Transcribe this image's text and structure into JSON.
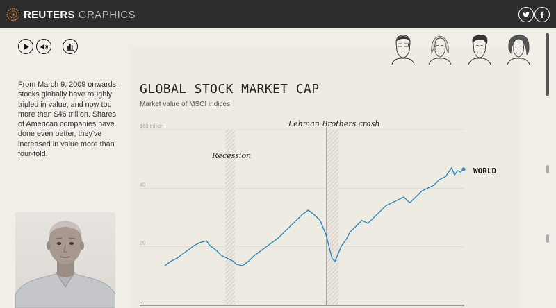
{
  "header": {
    "brand": "REUTERS",
    "brand_sub": "GRAPHICS",
    "twitter_icon": "twitter-icon",
    "facebook_icon": "facebook-icon"
  },
  "controls": {
    "play_icon": "play-icon",
    "sound_icon": "speaker-icon",
    "chart_icon": "bar-chart-icon"
  },
  "narration": {
    "text": "From March 9, 2009 onwards, stocks globally have roughly tripled in value, and now top more than $46 trillion. Shares of American companies have done even better, they've increased in value more than four-fold."
  },
  "chart_data": {
    "type": "line",
    "title": "GLOBAL STOCK MARKET CAP",
    "subtitle": "Market value of MSCI indices",
    "ylabel": "",
    "xlabel": "",
    "ylim": [
      0,
      60
    ],
    "yticks": [
      {
        "value": 0,
        "label": "0"
      },
      {
        "value": 20,
        "label": "20"
      },
      {
        "value": 40,
        "label": "40"
      },
      {
        "value": 60,
        "label": "$60 trillion"
      }
    ],
    "grid": true,
    "xlim": [
      0,
      100
    ],
    "series": [
      {
        "name": "WORLD",
        "color": "#2a8ab8",
        "x": [
          0,
          2,
          4,
          6,
          8,
          10,
          12,
          14,
          15,
          17,
          19,
          21,
          23,
          24,
          26,
          28,
          30,
          32,
          34,
          36,
          38,
          40,
          42,
          44,
          46,
          48,
          50,
          52,
          54,
          55,
          56,
          57,
          58,
          59,
          60,
          61,
          62,
          64,
          66,
          68,
          70,
          72,
          74,
          76,
          78,
          80,
          82,
          84,
          86,
          88,
          90,
          92,
          94,
          96,
          97,
          98,
          99,
          100
        ],
        "values": [
          13.5,
          15,
          16,
          17.5,
          19,
          20.5,
          21.5,
          22,
          20.5,
          19,
          17,
          16,
          15,
          14,
          13.5,
          15,
          17,
          18.5,
          20,
          21.5,
          23,
          25,
          27,
          29,
          31,
          32.5,
          31,
          29,
          24,
          20,
          16,
          15,
          17.5,
          20,
          21.5,
          23,
          25,
          27,
          29,
          28,
          30,
          32,
          34,
          35,
          36,
          37,
          35,
          37,
          39,
          40,
          41,
          43,
          44,
          47,
          44.5,
          46,
          45.5,
          46.5
        ]
      }
    ],
    "bands": [
      {
        "label": "Recession",
        "from": 20.3,
        "to": 23.5
      },
      {
        "label": "Lehman Brothers crash",
        "from": 54.2,
        "to": 58.2
      }
    ],
    "event_line": {
      "x": 54.2
    },
    "series_label": "WORLD"
  },
  "scroll": {
    "thumb": 0.05
  }
}
